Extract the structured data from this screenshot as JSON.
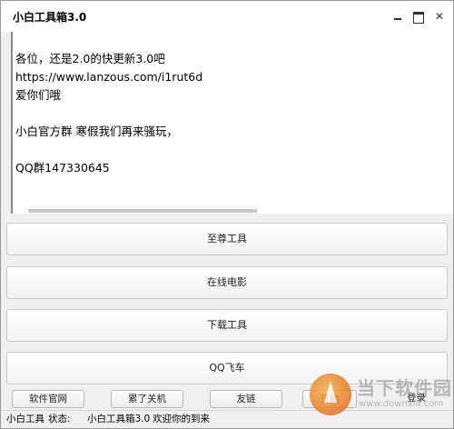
{
  "window": {
    "title": "小白工具箱3.0"
  },
  "notice": {
    "lines": [
      "各位，还是2.0的快更新3.0吧",
      "https://www.lanzous.com/i1rut6d",
      "爱你们哦",
      "",
      "小白官方群  寒假我们再来骚玩，",
      "",
      "QQ群147330645"
    ]
  },
  "main_buttons": {
    "b1": "至尊工具",
    "b2": "在线电影",
    "b3": "下载工具",
    "b4": "QQ飞车"
  },
  "bottom_buttons": {
    "official_site": "软件官网",
    "shutdown": "累了关机",
    "links": "友链",
    "donate": "赞助",
    "login": "登录"
  },
  "status": {
    "app": "小白工具",
    "label": "状态:",
    "app_name": "小白工具箱3.0",
    "message": "欢迎你的到来"
  },
  "watermark": {
    "cn": "当下软件园",
    "en": "www.downxia.com"
  }
}
